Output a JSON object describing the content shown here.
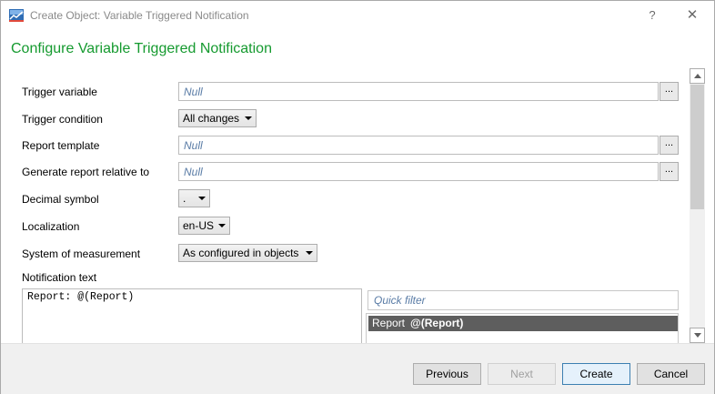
{
  "window": {
    "title": "Create Object: Variable Triggered Notification",
    "help_label": "?",
    "close_label": "✕"
  },
  "heading": "Configure Variable Triggered Notification",
  "fields": {
    "trigger_variable": {
      "label": "Trigger variable",
      "placeholder": "Null",
      "button_label": "..."
    },
    "trigger_condition": {
      "label": "Trigger condition",
      "value": "All changes"
    },
    "report_template": {
      "label": "Report template",
      "placeholder": "Null",
      "button_label": "..."
    },
    "report_relative": {
      "label": "Generate report relative to",
      "placeholder": "Null",
      "button_label": "..."
    },
    "decimal_symbol": {
      "label": "Decimal symbol",
      "value": "."
    },
    "localization": {
      "label": "Localization",
      "value": "en-US"
    },
    "measurement": {
      "label": "System of measurement",
      "value": "As configured in objects"
    },
    "notification_text": {
      "label": "Notification text",
      "value": "Report: @(Report)"
    }
  },
  "quick_filter": {
    "placeholder": "Quick filter"
  },
  "variables": [
    {
      "name": "Report",
      "token": "@(Report)",
      "selected": true
    }
  ],
  "footer": {
    "previous_label": "Previous",
    "next_label": "Next",
    "create_label": "Create",
    "cancel_label": "Cancel"
  },
  "colors": {
    "heading": "#159a2f",
    "placeholder": "#5a7ca6",
    "selected_item_bg": "#5e5e5e"
  }
}
